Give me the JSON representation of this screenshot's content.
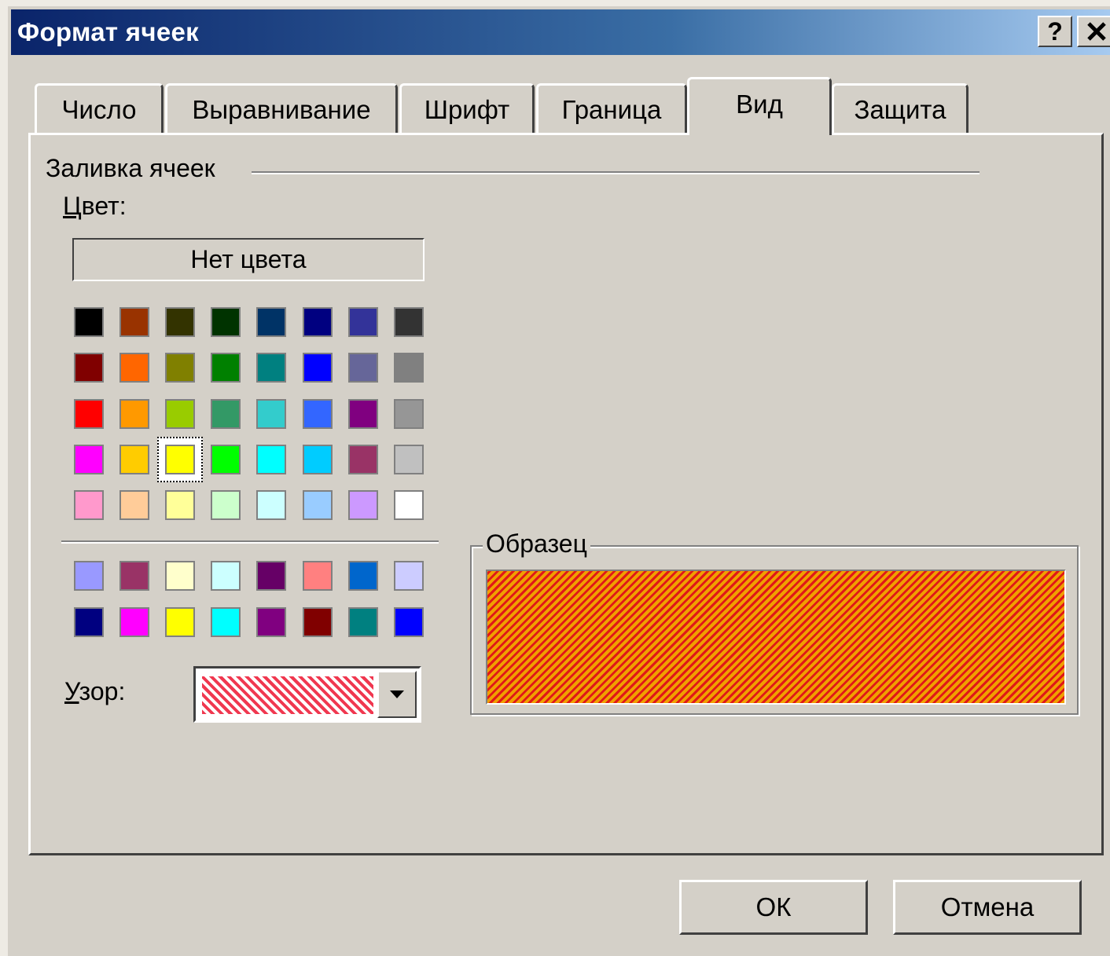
{
  "window": {
    "title": "Формат ячеек",
    "help_label": "?"
  },
  "tabs": [
    {
      "label": "Число",
      "active": false
    },
    {
      "label": "Выравнивание",
      "active": false
    },
    {
      "label": "Шрифт",
      "active": false
    },
    {
      "label": "Граница",
      "active": false
    },
    {
      "label": "Вид",
      "active": true
    },
    {
      "label": "Защита",
      "active": false
    }
  ],
  "fill": {
    "group_label": "Заливка ячеек",
    "color_label": "Цвет:",
    "no_color_label": "Нет цвета",
    "selected_color": "#ffff00",
    "palette_main": [
      [
        "#000000",
        "#993300",
        "#333300",
        "#003300",
        "#003366",
        "#000080",
        "#333399",
        "#333333"
      ],
      [
        "#800000",
        "#ff6600",
        "#808000",
        "#008000",
        "#008080",
        "#0000ff",
        "#666699",
        "#808080"
      ],
      [
        "#ff0000",
        "#ff9900",
        "#99cc00",
        "#339966",
        "#33cccc",
        "#3366ff",
        "#800080",
        "#969696"
      ],
      [
        "#ff00ff",
        "#ffcc00",
        "#ffff00",
        "#00ff00",
        "#00ffff",
        "#00ccff",
        "#993366",
        "#c0c0c0"
      ],
      [
        "#ff99cc",
        "#ffcc99",
        "#ffff99",
        "#ccffcc",
        "#ccffff",
        "#99ccff",
        "#cc99ff",
        "#ffffff"
      ]
    ],
    "palette_extra": [
      [
        "#9999ff",
        "#993366",
        "#ffffcc",
        "#ccffff",
        "#660066",
        "#ff8080",
        "#0066cc",
        "#ccccff"
      ],
      [
        "#000080",
        "#ff00ff",
        "#ffff00",
        "#00ffff",
        "#800080",
        "#800000",
        "#008080",
        "#0000ff"
      ]
    ],
    "pattern_label": "Узор:"
  },
  "sample": {
    "label": "Образец"
  },
  "buttons": {
    "ok": "ОК",
    "cancel": "Отмена"
  }
}
